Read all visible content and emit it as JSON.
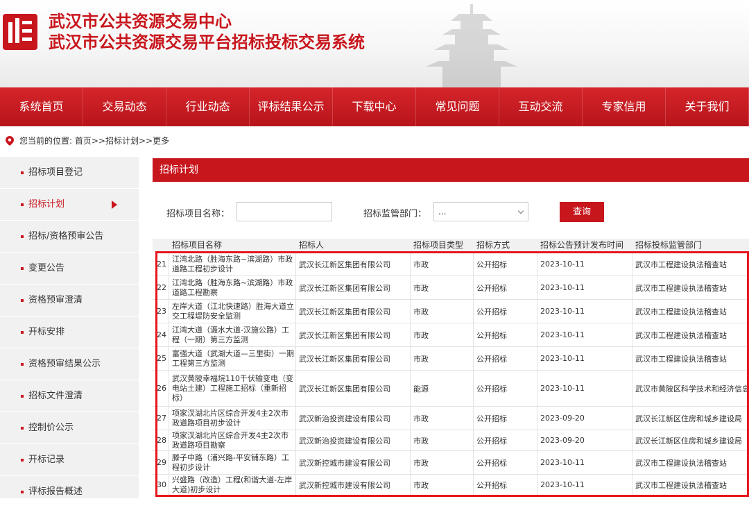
{
  "header": {
    "title": "武汉市公共资源交易中心",
    "subtitle": "武汉市公共资源交易平台招标投标交易系统"
  },
  "nav": [
    "系统首页",
    "交易动态",
    "行业动态",
    "评标结果公示",
    "下载中心",
    "常见问题",
    "互动交流",
    "专家信用",
    "关于我们"
  ],
  "breadcrumb": "您当前的位置: 首页>>招标计划>>更多",
  "sidebar": {
    "items": [
      {
        "label": "招标项目登记"
      },
      {
        "label": "招标计划"
      },
      {
        "label": "招标/资格预审公告"
      },
      {
        "label": "变更公告"
      },
      {
        "label": "资格预审澄清"
      },
      {
        "label": "开标安排"
      },
      {
        "label": "资格预审结果公示"
      },
      {
        "label": "招标文件澄清"
      },
      {
        "label": "控制价公示"
      },
      {
        "label": "开标记录"
      },
      {
        "label": "评标报告概述"
      }
    ],
    "active_index": 1
  },
  "main": {
    "title": "招标计划",
    "filter": {
      "name_label": "招标项目名称：",
      "name_value": "",
      "dept_label": "招标监管部门：",
      "dept_value": "...",
      "query_label": "查询"
    }
  },
  "table": {
    "headers": [
      "招标项目名称",
      "招标人",
      "招标项目类型",
      "招标方式",
      "招标公告预计发布时间",
      "招标投标监管部门"
    ],
    "rows": [
      {
        "no": "21",
        "name": "江湾北路（胜海东路~滨湖路）市政道路工程初步设计",
        "tenderer": "武汉长江新区集团有限公司",
        "type": "市政",
        "method": "公开招标",
        "date": "2023-10-11",
        "dept": "武汉市工程建设执法稽查站"
      },
      {
        "no": "22",
        "name": "江湾北路（胜海东路~滨湖路）市政道路工程勘察",
        "tenderer": "武汉长江新区集团有限公司",
        "type": "市政",
        "method": "公开招标",
        "date": "2023-10-11",
        "dept": "武汉市工程建设执法稽查站"
      },
      {
        "no": "23",
        "name": "左岸大道（江北快速路）胜海大道立交工程堤防安全监测",
        "tenderer": "武汉长江新区集团有限公司",
        "type": "市政",
        "method": "公开招标",
        "date": "2023-10-11",
        "dept": "武汉市工程建设执法稽查站"
      },
      {
        "no": "24",
        "name": "江湾大道（滠水大道-汉施公路）工程（一期）第三方监测",
        "tenderer": "武汉长江新区集团有限公司",
        "type": "市政",
        "method": "公开招标",
        "date": "2023-10-11",
        "dept": "武汉市工程建设执法稽查站"
      },
      {
        "no": "25",
        "name": "富强大道（武湖大道—三里街）一期工程第三方监测",
        "tenderer": "武汉长江新区集团有限公司",
        "type": "市政",
        "method": "公开招标",
        "date": "2023-10-11",
        "dept": "武汉市工程建设执法稽查站"
      },
      {
        "no": "26",
        "name": "武汉黄陂幸福垸110千伏输变电（变电站土建）工程施工招标（重新招标）",
        "tenderer": "武汉长江新区集团有限公司",
        "type": "能源",
        "method": "公开招标",
        "date": "2023-10-11",
        "dept": "武汉市黄陂区科学技术和经济信息"
      },
      {
        "no": "27",
        "name": "项家汊湖北片区综合开发4主2次市政道路项目初步设计",
        "tenderer": "武汉新治投资建设有限公司",
        "type": "市政",
        "method": "公开招标",
        "date": "2023-09-20",
        "dept": "武汉长江新区住房和城乡建设局"
      },
      {
        "no": "28",
        "name": "项家汊湖北片区综合开发4主2次市政道路项目勘察",
        "tenderer": "武汉新治投资建设有限公司",
        "type": "市政",
        "method": "公开招标",
        "date": "2023-09-20",
        "dept": "武汉长江新区住房和城乡建设局"
      },
      {
        "no": "29",
        "name": "滕子中路（浦兴路-平安铺东路）工程初步设计",
        "tenderer": "武汉新控城市建设有限公司",
        "type": "市政",
        "method": "公开招标",
        "date": "2023-10-11",
        "dept": "武汉市工程建设执法稽查站"
      },
      {
        "no": "30",
        "name": "兴盛路（改造）工程(和谐大道-左岸大道)初步设计",
        "tenderer": "武汉新控城市建设有限公司",
        "type": "市政",
        "method": "公开招标",
        "date": "2023-10-11",
        "dept": "武汉市工程建设执法稽查站"
      }
    ]
  },
  "colors": {
    "brand_red": "#c8161d",
    "highlight_red": "#e8141c"
  }
}
